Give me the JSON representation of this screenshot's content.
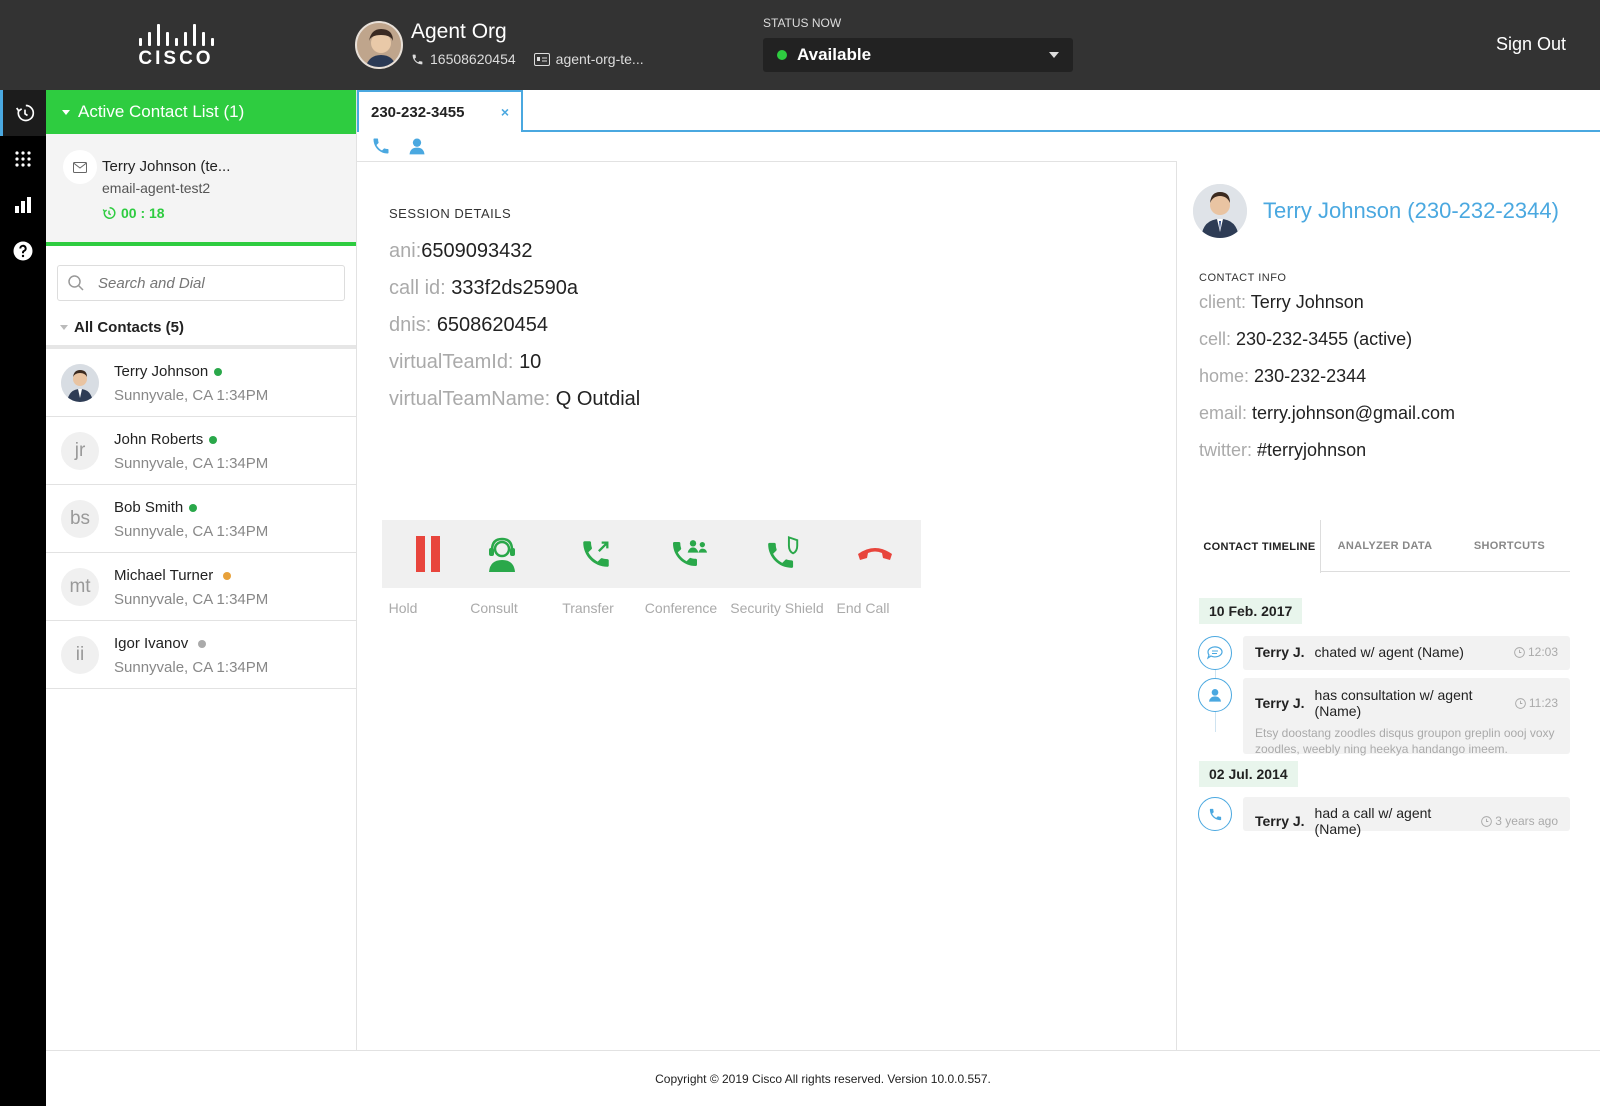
{
  "header": {
    "logo_text": "CISCO",
    "agent_name": "Agent Org",
    "agent_phone": "16508620454",
    "agent_id": "agent-org-te...",
    "status_label": "STATUS NOW",
    "status_value": "Available",
    "sign_out": "Sign Out"
  },
  "rail": {
    "items": [
      "recent-icon",
      "dialpad-icon",
      "stats-icon",
      "help-icon"
    ]
  },
  "contacts": {
    "active_header": "Active Contact List (1)",
    "active_item": {
      "name": "Terry Johnson (te...",
      "sub": "email-agent-test2",
      "timer": "00 : 18"
    },
    "search_placeholder": "Search and Dial",
    "all_header": "All Contacts (5)",
    "list": [
      {
        "initials": "",
        "name": "Terry Johnson",
        "location": "Sunnyvale, CA 1:34PM",
        "status_color": "#2aa84a"
      },
      {
        "initials": "jr",
        "name": "John Roberts",
        "location": "Sunnyvale, CA 1:34PM",
        "status_color": "#2aa84a"
      },
      {
        "initials": "bs",
        "name": "Bob Smith",
        "location": "Sunnyvale, CA 1:34PM",
        "status_color": "#2aa84a"
      },
      {
        "initials": "mt",
        "name": "Michael Turner",
        "location": "Sunnyvale, CA 1:34PM",
        "status_color": "#e8a13a"
      },
      {
        "initials": "ii",
        "name": "Igor Ivanov",
        "location": "Sunnyvale, CA 1:34PM",
        "status_color": "#aaaaaa"
      }
    ]
  },
  "tab": {
    "label": "230-232-3455",
    "close": "×"
  },
  "session": {
    "title": "SESSION DETAILS",
    "fields": [
      {
        "key": "ani:",
        "value": "6509093432"
      },
      {
        "key": "call id:",
        "value": "333f2ds2590a"
      },
      {
        "key": "dnis:",
        "value": "6508620454"
      },
      {
        "key": "virtualTeamId:",
        "value": "10"
      },
      {
        "key": "virtualTeamName:",
        "value": "Q Outdial"
      }
    ],
    "actions": [
      {
        "label": "Hold",
        "icon": "hold-icon"
      },
      {
        "label": "Consult",
        "icon": "consult-icon"
      },
      {
        "label": "Transfer",
        "icon": "transfer-icon"
      },
      {
        "label": "Conference",
        "icon": "conference-icon"
      },
      {
        "label": "Security Shield",
        "icon": "security-shield-icon"
      },
      {
        "label": "End Call",
        "icon": "end-call-icon"
      }
    ]
  },
  "customer": {
    "name": "Terry Johnson (230-232-2344)",
    "info_title": "CONTACT INFO",
    "fields": [
      {
        "key": "client:",
        "value": "Terry Johnson"
      },
      {
        "key": "cell:",
        "value": "230-232-3455 (active)"
      },
      {
        "key": "home:",
        "value": "230-232-2344"
      },
      {
        "key": "email:",
        "value": "terry.johnson@gmail.com"
      },
      {
        "key": "twitter:",
        "value": "#terryjohnson"
      }
    ],
    "tabs": [
      "CONTACT TIMELINE",
      "ANALYZER DATA",
      "SHORTCUTS"
    ],
    "timeline": {
      "date1": "10 Feb. 2017",
      "date2": "02 Jul. 2014",
      "events": [
        {
          "who": "Terry J.",
          "what": "chated w/ agent (Name)",
          "time": "12:03",
          "note": "",
          "icon": "chat-icon"
        },
        {
          "who": "Terry J.",
          "what": "has consultation w/ agent (Name)",
          "time": "11:23",
          "note": "Etsy doostang zoodles disqus groupon greplin oooj voxy zoodles, weebly ning heekya handango imeem.",
          "icon": "agent-icon"
        },
        {
          "who": "Terry J.",
          "what": "had a call w/ agent (Name)",
          "time": "3 years ago",
          "note": "",
          "icon": "phone-icon"
        }
      ]
    }
  },
  "footer": {
    "text": "Copyright © 2019 Cisco All rights reserved. Version 10.0.0.557."
  }
}
